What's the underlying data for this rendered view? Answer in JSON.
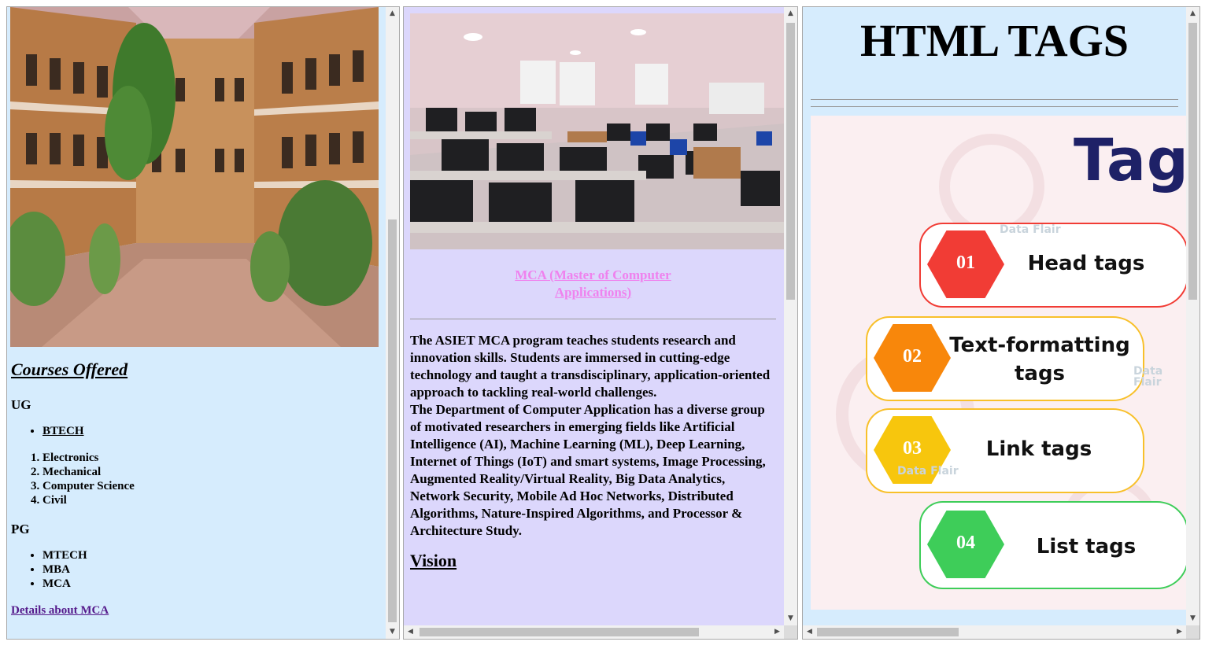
{
  "frame_left": {
    "heading": "Courses Offered",
    "ug": {
      "label": "UG",
      "program": "BTECH",
      "branches": [
        "Electronics",
        "Mechanical",
        "Computer Science",
        "Civil"
      ]
    },
    "pg": {
      "label": "PG",
      "programs": [
        "MTECH",
        "MBA",
        "MCA"
      ]
    },
    "details_link": "Details about MCA"
  },
  "frame_middle": {
    "title_line1": "MCA (Master of Computer",
    "title_line2": "Applications)",
    "para1": "The ASIET MCA program teaches students research and innovation skills. Students are immersed in cutting-edge technology and taught a transdisciplinary, application-oriented approach to tackling real-world challenges.",
    "para2": "The Department of Computer Application has a diverse group of motivated researchers in emerging fields like Artificial Intelligence (AI), Machine Learning (ML), Deep Learning, Internet of Things (IoT) and smart systems, Image Processing, Augmented Reality/Virtual Reality, Big Data Analytics, Network Security, Mobile Ad Hoc Networks, Distributed Algorithms, Nature-Inspired Algorithms, and Processor & Architecture Study.",
    "vision_heading": "Vision"
  },
  "frame_right": {
    "title": "HTML TAGS",
    "infographic": {
      "heading": "Tag",
      "watermark": "Data Flair",
      "items": [
        {
          "num": "01",
          "line1": "Head tags",
          "line2": "",
          "color": "#f13c35"
        },
        {
          "num": "02",
          "line1": "Text-formatting",
          "line2": "tags",
          "color": "#f8870b"
        },
        {
          "num": "03",
          "line1": "Link tags",
          "line2": "",
          "color": "#f7c60d"
        },
        {
          "num": "04",
          "line1": "List tags",
          "line2": "",
          "color": "#3ecd59"
        }
      ]
    }
  },
  "colors": {
    "frame_left_bg": "#d6ecfd",
    "frame_middle_bg": "#dcd7fc",
    "title_pink": "#ef82ee",
    "link_purple": "#551a8b",
    "tag_navy": "#1e2167"
  }
}
